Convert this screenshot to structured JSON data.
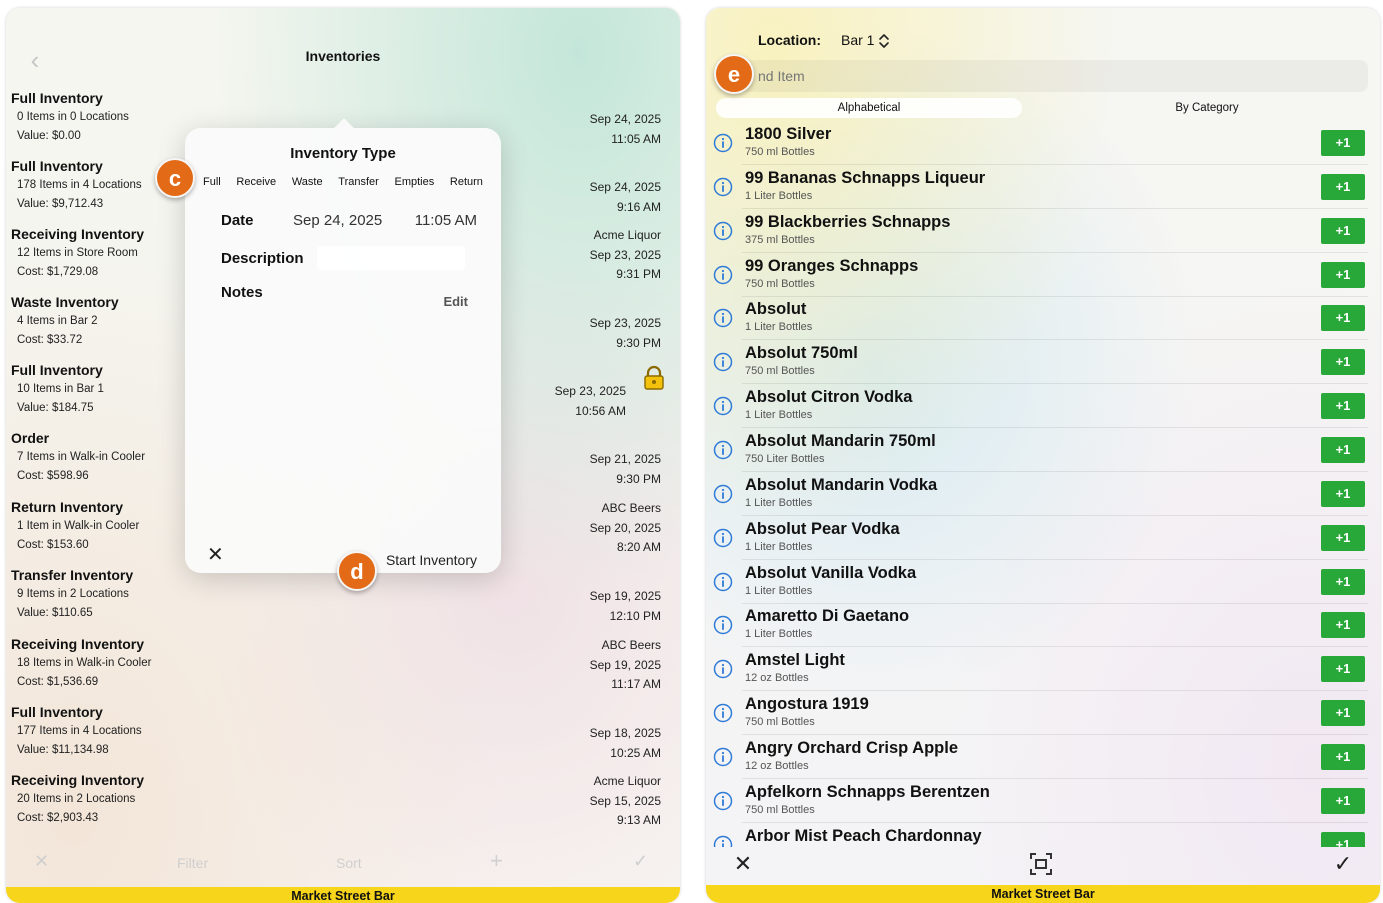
{
  "left": {
    "title": "Inventories",
    "rows": [
      {
        "title": "Full Inventory",
        "line1": "0 Items in 0 Locations",
        "line2": "Value: $0.00",
        "right": [
          "Sep 24, 2025",
          "11:05 AM"
        ]
      },
      {
        "title": "Full Inventory",
        "line1": "178 Items in 4 Locations",
        "line2": "Value: $9,712.43",
        "right": [
          "Sep 24, 2025",
          "9:16 AM"
        ]
      },
      {
        "title": "Receiving Inventory",
        "line1": "12 Items in Store Room",
        "line2": "Cost: $1,729.08",
        "right": [
          "Acme Liquor",
          "Sep 23, 2025",
          "9:31 PM"
        ]
      },
      {
        "title": "Waste Inventory",
        "line1": "4 Items in Bar 2",
        "line2": "Cost: $33.72",
        "right": [
          "Sep 23, 2025",
          "9:30 PM"
        ]
      },
      {
        "title": "Full Inventory",
        "line1": "10 Items in Bar 1",
        "line2": "Value: $184.75",
        "right": [
          "Sep 23, 2025",
          "10:56 AM"
        ],
        "locked": true
      },
      {
        "title": "Order",
        "line1": "7 Items in Walk-in Cooler",
        "line2": "Cost: $598.96",
        "right": [
          "Sep 21, 2025",
          "9:30 PM"
        ]
      },
      {
        "title": "Return Inventory",
        "line1": "1 Item in Walk-in Cooler",
        "line2": "Cost: $153.60",
        "right": [
          "ABC Beers",
          "Sep 20, 2025",
          "8:20 AM"
        ]
      },
      {
        "title": "Transfer Inventory",
        "line1": "9 Items in 2 Locations",
        "line2": "Value: $110.65",
        "right": [
          "Sep 19, 2025",
          "12:10 PM"
        ]
      },
      {
        "title": "Receiving Inventory",
        "line1": "18 Items in Walk-in Cooler",
        "line2": "Cost: $1,536.69",
        "right": [
          "ABC Beers",
          "Sep 19, 2025",
          "11:17 AM"
        ]
      },
      {
        "title": "Full Inventory",
        "line1": "177 Items in 4 Locations",
        "line2": "Value: $11,134.98",
        "right": [
          "Sep 18, 2025",
          "10:25 AM"
        ]
      },
      {
        "title": "Receiving Inventory",
        "line1": "20 Items in 2 Locations",
        "line2": "Cost: $2,903.43",
        "right": [
          "Acme Liquor",
          "Sep 15, 2025",
          "9:13 AM"
        ]
      }
    ],
    "toolbar": {
      "filter": "Filter",
      "sort": "Sort"
    },
    "footer": "Market Street Bar",
    "modal": {
      "title": "Inventory Type",
      "types": [
        "Full",
        "Receive",
        "Waste",
        "Transfer",
        "Empties",
        "Return"
      ],
      "date_label": "Date",
      "date_value": "Sep 24, 2025",
      "time_value": "11:05 AM",
      "description_label": "Description",
      "description_value": "",
      "notes_label": "Notes",
      "edit_label": "Edit",
      "start_label": "Start Inventory"
    },
    "badges": {
      "c": "c",
      "d": "d"
    }
  },
  "right": {
    "location_label": "Location:",
    "location_value": "Bar 1",
    "search_placeholder": "nd Item",
    "tabs": [
      "Alphabetical",
      "By Category"
    ],
    "plus_label": "+1",
    "items": [
      {
        "name": "1800 Silver",
        "size": "750 ml Bottles"
      },
      {
        "name": "99 Bananas Schnapps Liqueur",
        "size": "1 Liter Bottles"
      },
      {
        "name": "99 Blackberries Schnapps",
        "size": "375 ml Bottles"
      },
      {
        "name": "99 Oranges Schnapps",
        "size": "750 ml Bottles"
      },
      {
        "name": "Absolut",
        "size": "1 Liter Bottles"
      },
      {
        "name": "Absolut 750ml",
        "size": "750 ml Bottles"
      },
      {
        "name": "Absolut Citron Vodka",
        "size": "1 Liter Bottles"
      },
      {
        "name": "Absolut Mandarin 750ml",
        "size": "750 Liter Bottles"
      },
      {
        "name": "Absolut Mandarin Vodka",
        "size": "1 Liter Bottles"
      },
      {
        "name": "Absolut Pear Vodka",
        "size": "1 Liter Bottles"
      },
      {
        "name": "Absolut Vanilla Vodka",
        "size": "1 Liter Bottles"
      },
      {
        "name": "Amaretto Di Gaetano",
        "size": "1 Liter Bottles"
      },
      {
        "name": "Amstel Light",
        "size": "12 oz Bottles"
      },
      {
        "name": "Angostura 1919",
        "size": "750 ml Bottles"
      },
      {
        "name": "Angry Orchard Crisp Apple",
        "size": "12 oz Bottles"
      },
      {
        "name": "Apfelkorn Schnapps Berentzen",
        "size": "750 ml Bottles"
      },
      {
        "name": "Arbor Mist Peach Chardonnay",
        "size": ""
      }
    ],
    "footer": "Market Street Bar",
    "badges": {
      "e": "e"
    }
  }
}
